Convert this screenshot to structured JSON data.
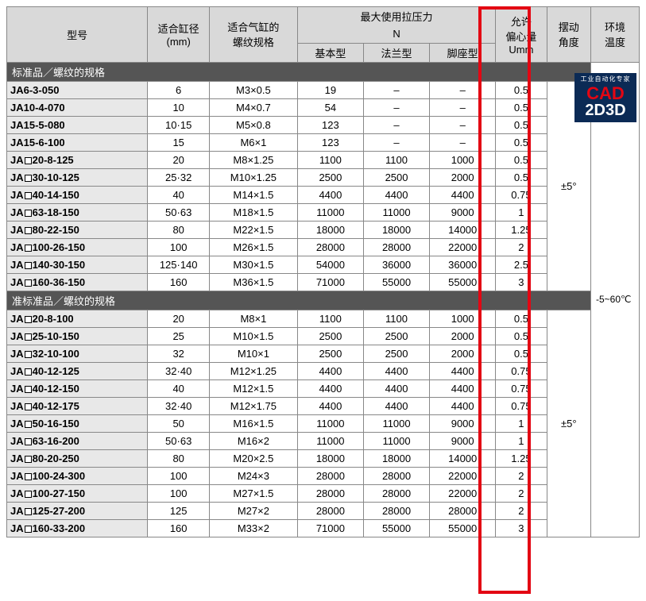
{
  "headers": {
    "model": "型号",
    "bore": "适合缸径",
    "bore_unit": "(mm)",
    "thread": "适合气缸的",
    "thread2": "螺纹规格",
    "max_press": "最大使用拉压力",
    "max_press_unit": "N",
    "basic": "基本型",
    "flange": "法兰型",
    "foot": "脚座型",
    "ecc": "允许",
    "ecc2": "偏心量",
    "ecc_unit": "Umm",
    "angle": "摆动",
    "angle2": "角度",
    "temp": "环境",
    "temp2": "温度"
  },
  "sections": [
    {
      "title": "标准品／螺纹的规格",
      "angle": "±5°",
      "rows": [
        {
          "model_pre": "JA6-3-050",
          "model_post": "",
          "has_box": false,
          "bore": "6",
          "thread": "M3×0.5",
          "basic": "19",
          "flange": "–",
          "foot": "–",
          "ecc": "0.5"
        },
        {
          "model_pre": "JA10-4-070",
          "model_post": "",
          "has_box": false,
          "bore": "10",
          "thread": "M4×0.7",
          "basic": "54",
          "flange": "–",
          "foot": "–",
          "ecc": "0.5"
        },
        {
          "model_pre": "JA15-5-080",
          "model_post": "",
          "has_box": false,
          "bore": "10·15",
          "thread": "M5×0.8",
          "basic": "123",
          "flange": "–",
          "foot": "–",
          "ecc": "0.5"
        },
        {
          "model_pre": "JA15-6-100",
          "model_post": "",
          "has_box": false,
          "bore": "15",
          "thread": "M6×1",
          "basic": "123",
          "flange": "–",
          "foot": "–",
          "ecc": "0.5"
        },
        {
          "model_pre": "JA",
          "model_post": "20-8-125",
          "has_box": true,
          "bore": "20",
          "thread": "M8×1.25",
          "basic": "1100",
          "flange": "1100",
          "foot": "1000",
          "ecc": "0.5"
        },
        {
          "model_pre": "JA",
          "model_post": "30-10-125",
          "has_box": true,
          "bore": "25·32",
          "thread": "M10×1.25",
          "basic": "2500",
          "flange": "2500",
          "foot": "2000",
          "ecc": "0.5"
        },
        {
          "model_pre": "JA",
          "model_post": "40-14-150",
          "has_box": true,
          "bore": "40",
          "thread": "M14×1.5",
          "basic": "4400",
          "flange": "4400",
          "foot": "4400",
          "ecc": "0.75"
        },
        {
          "model_pre": "JA",
          "model_post": "63-18-150",
          "has_box": true,
          "bore": "50·63",
          "thread": "M18×1.5",
          "basic": "11000",
          "flange": "11000",
          "foot": "9000",
          "ecc": "1"
        },
        {
          "model_pre": "JA",
          "model_post": "80-22-150",
          "has_box": true,
          "bore": "80",
          "thread": "M22×1.5",
          "basic": "18000",
          "flange": "18000",
          "foot": "14000",
          "ecc": "1.25"
        },
        {
          "model_pre": "JA",
          "model_post": "100-26-150",
          "has_box": true,
          "bore": "100",
          "thread": "M26×1.5",
          "basic": "28000",
          "flange": "28000",
          "foot": "22000",
          "ecc": "2"
        },
        {
          "model_pre": "JA",
          "model_post": "140-30-150",
          "has_box": true,
          "bore": "125·140",
          "thread": "M30×1.5",
          "basic": "54000",
          "flange": "36000",
          "foot": "36000",
          "ecc": "2.5"
        },
        {
          "model_pre": "JA",
          "model_post": "160-36-150",
          "has_box": true,
          "bore": "160",
          "thread": "M36×1.5",
          "basic": "71000",
          "flange": "55000",
          "foot": "55000",
          "ecc": "3"
        }
      ]
    },
    {
      "title": "准标准品／螺纹的规格",
      "angle": "±5°",
      "rows": [
        {
          "model_pre": "JA",
          "model_post": "20-8-100",
          "has_box": true,
          "bore": "20",
          "thread": "M8×1",
          "basic": "1100",
          "flange": "1100",
          "foot": "1000",
          "ecc": "0.5"
        },
        {
          "model_pre": "JA",
          "model_post": "25-10-150",
          "has_box": true,
          "bore": "25",
          "thread": "M10×1.5",
          "basic": "2500",
          "flange": "2500",
          "foot": "2000",
          "ecc": "0.5"
        },
        {
          "model_pre": "JA",
          "model_post": "32-10-100",
          "has_box": true,
          "bore": "32",
          "thread": "M10×1",
          "basic": "2500",
          "flange": "2500",
          "foot": "2000",
          "ecc": "0.5"
        },
        {
          "model_pre": "JA",
          "model_post": "40-12-125",
          "has_box": true,
          "bore": "32·40",
          "thread": "M12×1.25",
          "basic": "4400",
          "flange": "4400",
          "foot": "4400",
          "ecc": "0.75"
        },
        {
          "model_pre": "JA",
          "model_post": "40-12-150",
          "has_box": true,
          "bore": "40",
          "thread": "M12×1.5",
          "basic": "4400",
          "flange": "4400",
          "foot": "4400",
          "ecc": "0.75"
        },
        {
          "model_pre": "JA",
          "model_post": "40-12-175",
          "has_box": true,
          "bore": "32·40",
          "thread": "M12×1.75",
          "basic": "4400",
          "flange": "4400",
          "foot": "4400",
          "ecc": "0.75"
        },
        {
          "model_pre": "JA",
          "model_post": "50-16-150",
          "has_box": true,
          "bore": "50",
          "thread": "M16×1.5",
          "basic": "11000",
          "flange": "11000",
          "foot": "9000",
          "ecc": "1"
        },
        {
          "model_pre": "JA",
          "model_post": "63-16-200",
          "has_box": true,
          "bore": "50·63",
          "thread": "M16×2",
          "basic": "11000",
          "flange": "11000",
          "foot": "9000",
          "ecc": "1"
        },
        {
          "model_pre": "JA",
          "model_post": "80-20-250",
          "has_box": true,
          "bore": "80",
          "thread": "M20×2.5",
          "basic": "18000",
          "flange": "18000",
          "foot": "14000",
          "ecc": "1.25"
        },
        {
          "model_pre": "JA",
          "model_post": "100-24-300",
          "has_box": true,
          "bore": "100",
          "thread": "M24×3",
          "basic": "28000",
          "flange": "28000",
          "foot": "22000",
          "ecc": "2"
        },
        {
          "model_pre": "JA",
          "model_post": "100-27-150",
          "has_box": true,
          "bore": "100",
          "thread": "M27×1.5",
          "basic": "28000",
          "flange": "28000",
          "foot": "22000",
          "ecc": "2"
        },
        {
          "model_pre": "JA",
          "model_post": "125-27-200",
          "has_box": true,
          "bore": "125",
          "thread": "M27×2",
          "basic": "28000",
          "flange": "28000",
          "foot": "28000",
          "ecc": "2"
        },
        {
          "model_pre": "JA",
          "model_post": "160-33-200",
          "has_box": true,
          "bore": "160",
          "thread": "M33×2",
          "basic": "71000",
          "flange": "55000",
          "foot": "55000",
          "ecc": "3"
        }
      ]
    }
  ],
  "temp_value": "-5~60℃",
  "logo": {
    "sub": "工业自动化专家",
    "line1": "CAD",
    "line2": "2D3D"
  }
}
